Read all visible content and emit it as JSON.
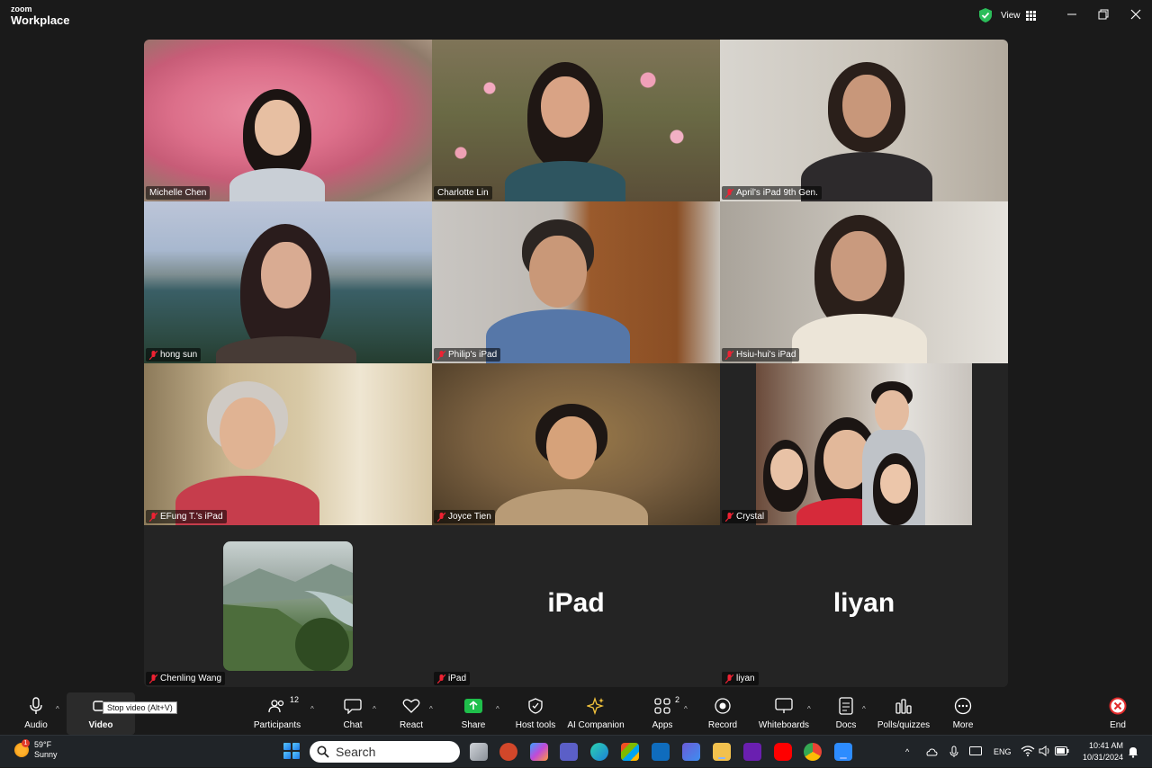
{
  "titlebar": {
    "brand_top": "zoom",
    "brand_bottom": "Workplace",
    "view_label": "View"
  },
  "participants": [
    {
      "name": "Michelle Chen",
      "muted": false,
      "active": false
    },
    {
      "name": "Charlotte Lin",
      "muted": false,
      "active": true
    },
    {
      "name": "April's iPad 9th Gen.",
      "muted": true,
      "active": false
    },
    {
      "name": "hong sun",
      "muted": true,
      "active": false
    },
    {
      "name": "Philip's iPad",
      "muted": true,
      "active": false
    },
    {
      "name": "Hsiu-hui's iPad",
      "muted": true,
      "active": false
    },
    {
      "name": "EFung T.'s iPad",
      "muted": true,
      "active": false
    },
    {
      "name": "Joyce Tien",
      "muted": true,
      "active": false
    },
    {
      "name": "Crystal",
      "muted": true,
      "active": false
    },
    {
      "name": "Chenling Wang",
      "muted": true,
      "active": false,
      "video": "avatar-image"
    },
    {
      "name": "iPad",
      "muted": true,
      "active": false,
      "big_label": "iPad"
    },
    {
      "name": "liyan",
      "muted": true,
      "active": false,
      "big_label": "liyan"
    }
  ],
  "toolbar": {
    "audio": "Audio",
    "video": "Video",
    "video_tooltip": "Stop video (Alt+V)",
    "participants": "Participants",
    "participants_count": "12",
    "chat": "Chat",
    "react": "React",
    "share": "Share",
    "host_tools": "Host tools",
    "ai_companion": "AI Companion",
    "apps": "Apps",
    "apps_count": "2",
    "record": "Record",
    "whiteboards": "Whiteboards",
    "docs": "Docs",
    "polls": "Polls/quizzes",
    "more": "More",
    "end": "End"
  },
  "taskbar": {
    "weather_temp": "59°F",
    "weather_desc": "Sunny",
    "weather_badge": "1",
    "search_placeholder": "Search",
    "language": "ENG",
    "time": "10:41 AM",
    "date": "10/31/2024"
  },
  "colors": {
    "active_speaker": "#3ccf7a",
    "share_green": "#1fbf4b",
    "end_red": "#e02a2a",
    "ai_gold": "#f3c33c"
  }
}
